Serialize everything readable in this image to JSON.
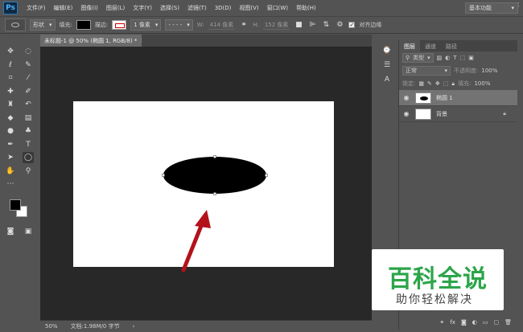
{
  "app": {
    "logo": "Ps"
  },
  "menu": [
    "文件(F)",
    "编辑(E)",
    "图像(I)",
    "图层(L)",
    "文字(Y)",
    "选择(S)",
    "滤镜(T)",
    "3D(D)",
    "视图(V)",
    "窗口(W)",
    "帮助(H)"
  ],
  "options": {
    "mode": "形状",
    "fill_label": "填充:",
    "stroke_label": "描边:",
    "stroke_width": "1 像素",
    "w_label": "W:",
    "w_value": "414 像素",
    "h_label": "H:",
    "h_value": "152 像素",
    "align_label": "对齐边缘",
    "workspace": "基本功能"
  },
  "document": {
    "tab_title": "未标题-1 @ 50% (椭圆 1, RGB/8) *",
    "zoom": "50%",
    "doc_info": "文档:1.98M/0 字节"
  },
  "layers_panel": {
    "tabs": [
      "图层",
      "通道",
      "路径"
    ],
    "filter_kind": "类型",
    "blend_mode": "正常",
    "opacity_label": "不透明度:",
    "opacity_value": "100%",
    "lock_label": "锁定:",
    "fill_label": "填充:",
    "fill_value": "100%",
    "layers": [
      {
        "name": "椭圆 1",
        "selected": true
      },
      {
        "name": "背景",
        "selected": false,
        "locked": true
      }
    ]
  },
  "watermark": {
    "title": "百科全说",
    "subtitle": "助你轻松解决"
  },
  "colors": {
    "arrow": "#b3121a",
    "watermark_green": "#2ca54a"
  }
}
